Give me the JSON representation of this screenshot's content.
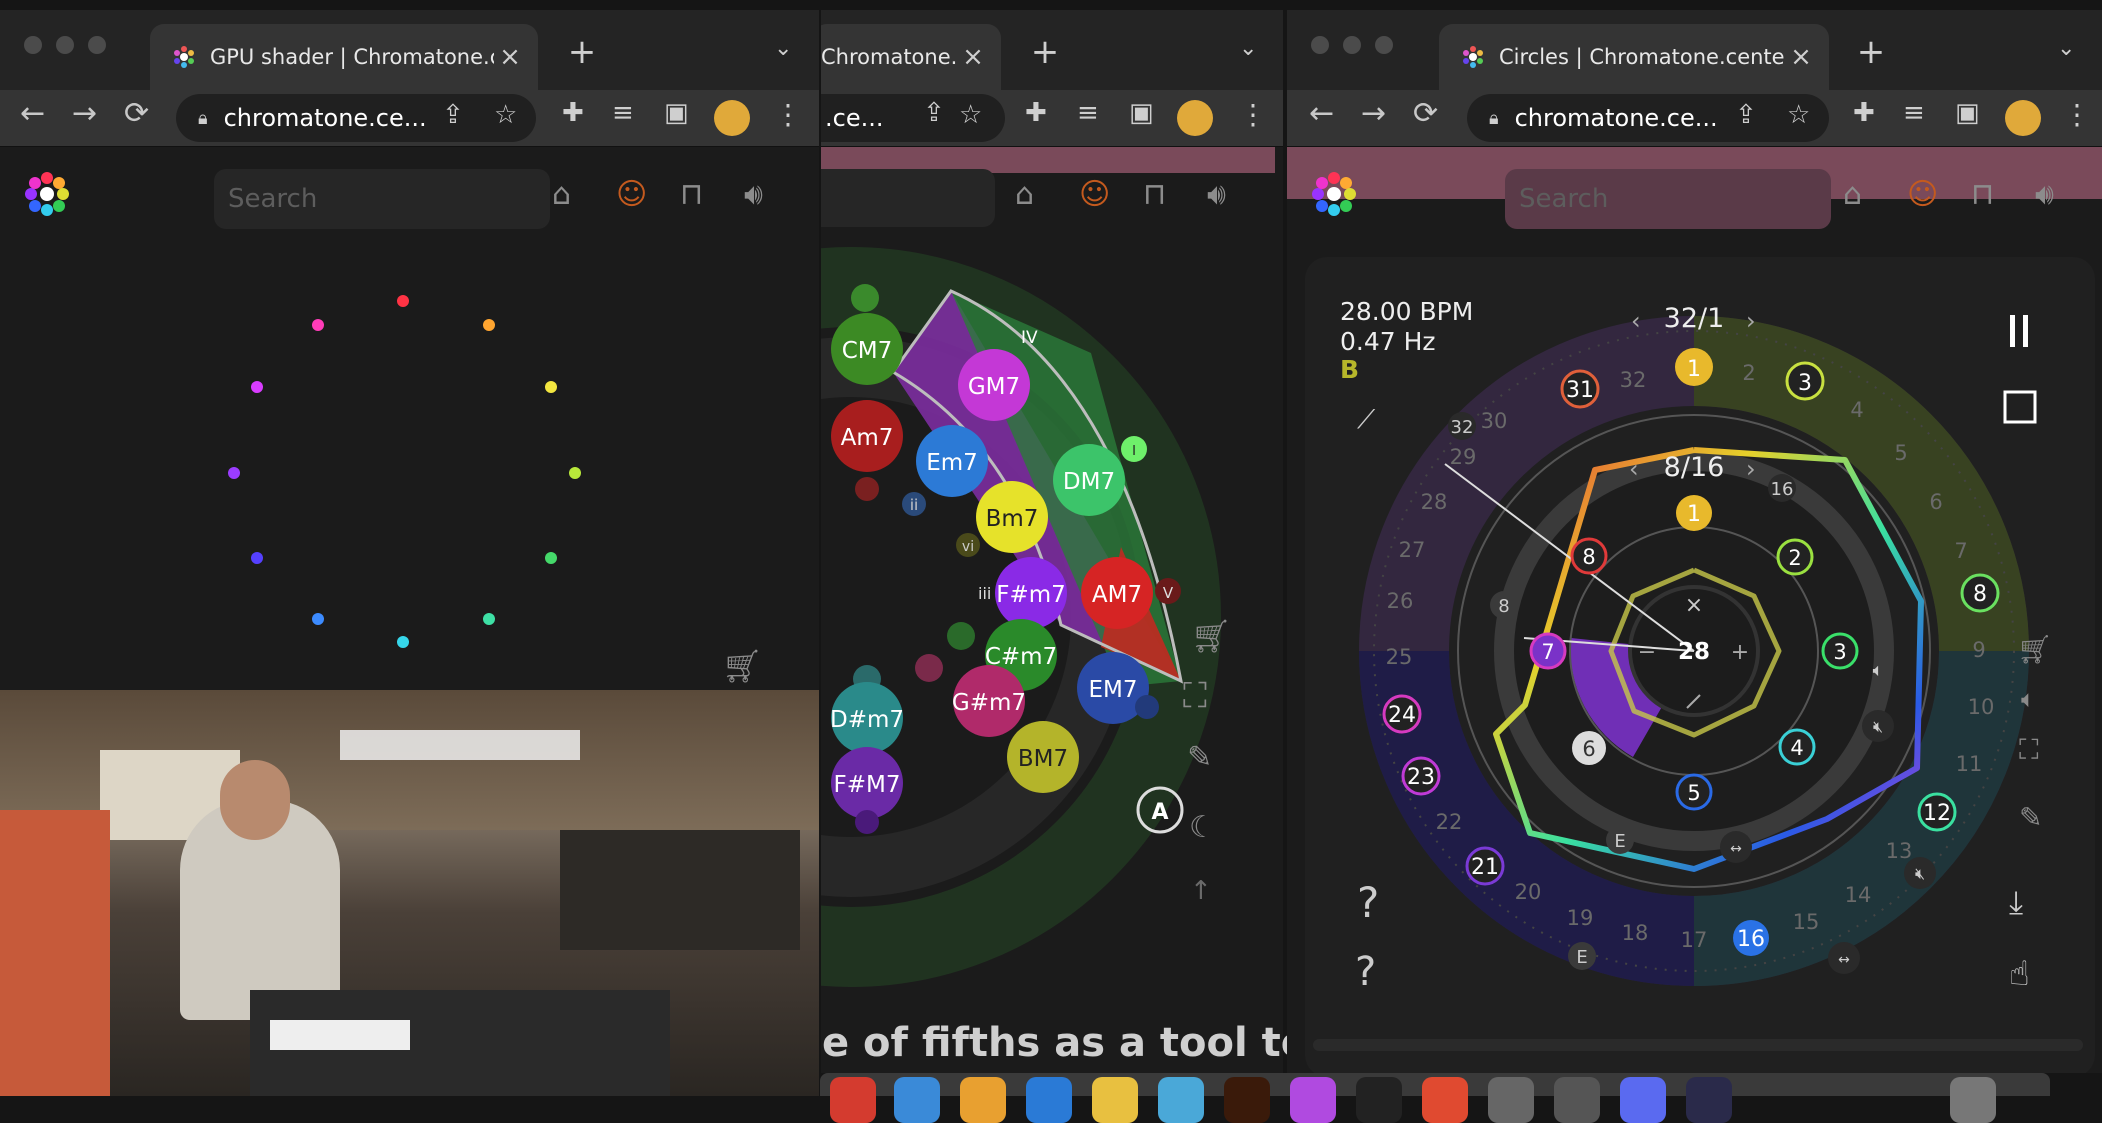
{
  "windows": {
    "left": {
      "tab_title": "GPU shader | Chromatone.center",
      "url": "chromatone.ce...",
      "search_placeholder": "Search"
    },
    "middle": {
      "tab_title": "Chromatone.ce",
      "url": ".ce...",
      "chords": [
        "CM7",
        "Am7",
        "GM7",
        "Em7",
        "DM7",
        "Bm7",
        "F#m7",
        "AM7",
        "C#m7",
        "EM7",
        "G#m7",
        "D#m7",
        "BM7",
        "F#M7"
      ],
      "degrees": [
        "IV",
        "ii",
        "vi",
        "iii",
        "V",
        "I"
      ],
      "caption": "e of fifths as a tool to",
      "a_button": "A"
    },
    "right": {
      "tab_title": "Circles | Chromatone.center",
      "url": "chromatone.ce...",
      "search_placeholder": "Search",
      "bpm": "28.00 BPM",
      "hz": "0.47 Hz",
      "note": "B",
      "outer_meter": "32/1",
      "inner_meter": "8/16",
      "center_value": "28",
      "center_close": "×",
      "center_minus": "−",
      "center_plus": "+",
      "outer_step_labels": [
        "1",
        "3",
        "8",
        "12",
        "16",
        "21",
        "23",
        "24",
        "31"
      ],
      "inner_step_labels": [
        "1",
        "2",
        "3",
        "4",
        "5",
        "6",
        "7",
        "8"
      ],
      "ring_numbers_outer": [
        "2",
        "4",
        "5",
        "6",
        "7",
        "9",
        "10",
        "11",
        "13",
        "14",
        "15",
        "17",
        "18",
        "19",
        "20",
        "22",
        "25",
        "26",
        "27",
        "28",
        "29",
        "30",
        "32"
      ],
      "small_labels": {
        "e1": "E",
        "e2": "E",
        "n32": "32",
        "n8": "8",
        "n16": "16"
      },
      "left_question": "?",
      "pause": "II"
    }
  },
  "colors": {
    "bg": "#1b1b1b",
    "tab_active": "#343434",
    "accent_yellow": "#e8b92c"
  },
  "icons": {
    "metronome": "metronome-icon",
    "face": "face-icon",
    "waveform": "square-wave-icon",
    "speaker": "speaker-icon",
    "cart": "cart-icon"
  }
}
